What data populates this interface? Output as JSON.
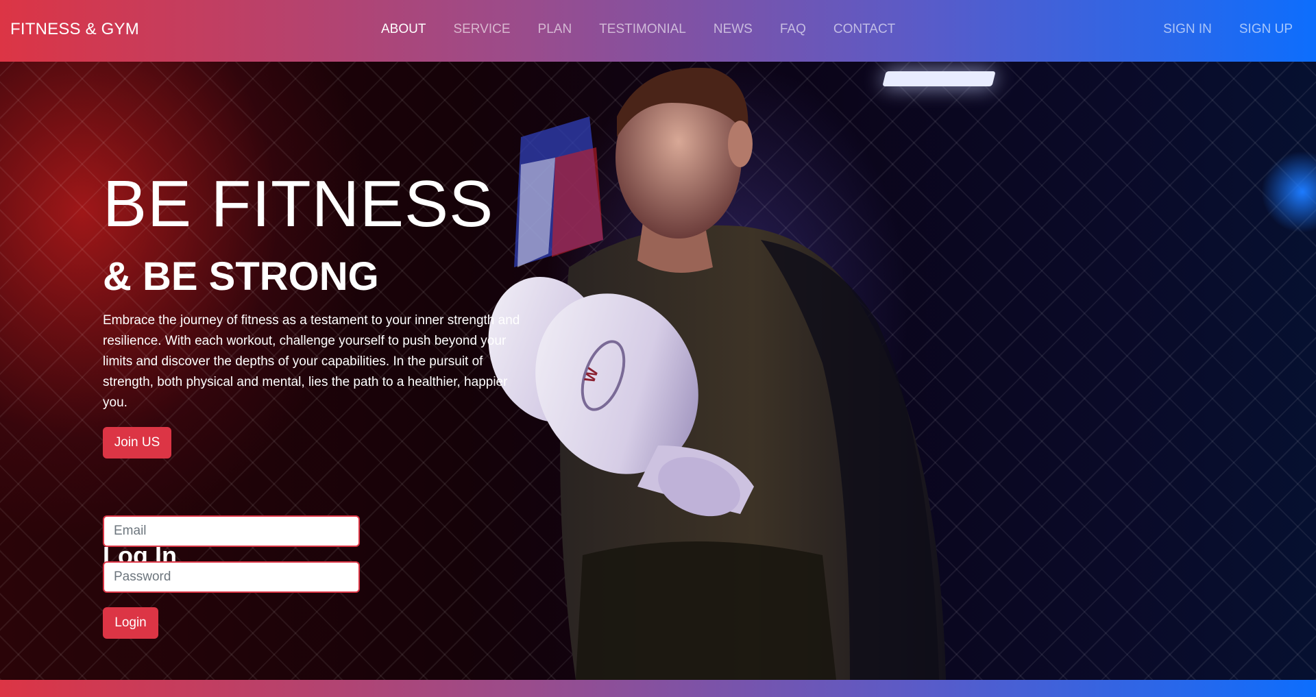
{
  "nav": {
    "brand": "FITNESS & GYM",
    "links": [
      "ABOUT",
      "SERVICE",
      "PLAN",
      "TESTIMONIAL",
      "NEWS",
      "FAQ",
      "CONTACT"
    ],
    "active_link": "ABOUT",
    "sign_in": "SIGN IN",
    "sign_up": "SIGN UP",
    "gradient": [
      "#dc3545",
      "#0d6efd"
    ]
  },
  "hero": {
    "title": "BE FITNESS",
    "subtitle": "& BE STRONG",
    "description": "Embrace the journey of fitness as a testament to your inner strength and resilience. With each workout, challenge yourself to push beyond your limits and discover the depths of your capabilities. In the pursuit of strength, both physical and mental, lies the path to a healthier, happier you.",
    "join_button": "Join US",
    "image_subject": "boxer-with-gloves-photo"
  },
  "login": {
    "title": "Log In",
    "email_placeholder": "Email",
    "password_placeholder": "Password",
    "button": "Login",
    "accent_color": "#dc3545"
  }
}
